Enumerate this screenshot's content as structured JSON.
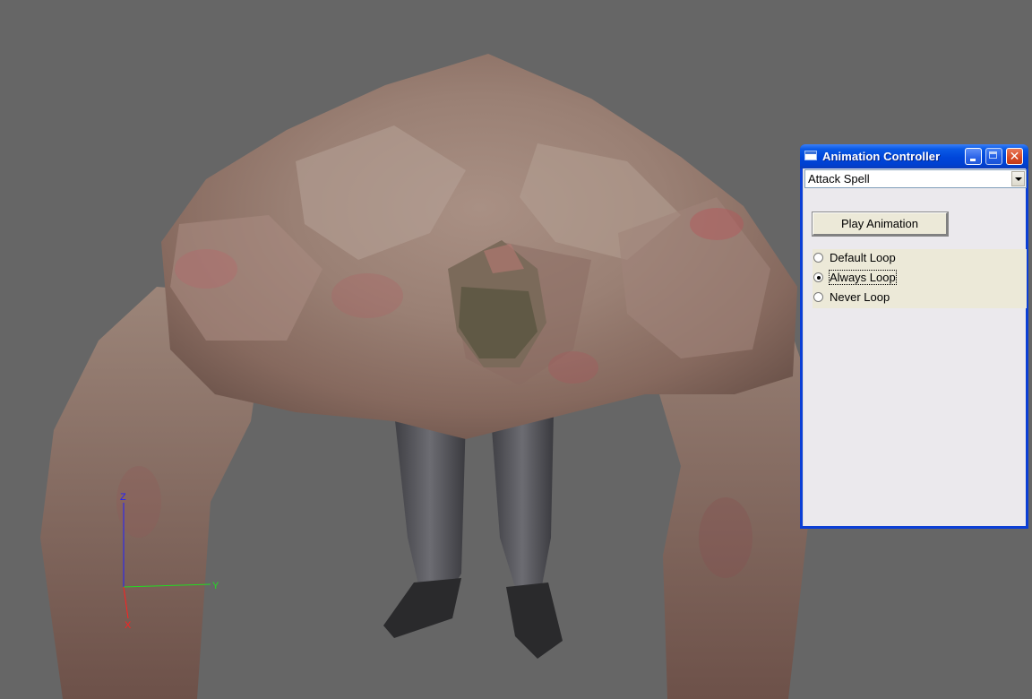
{
  "window": {
    "title": "Animation Controller",
    "animation_select": {
      "value": "Attack Spell"
    },
    "play_button": "Play Animation",
    "loop_options": [
      {
        "label": "Default Loop",
        "checked": false
      },
      {
        "label": "Always Loop",
        "checked": true
      },
      {
        "label": "Never Loop",
        "checked": false
      }
    ]
  },
  "axes": {
    "z": "Z",
    "y": "Y",
    "x": "X",
    "colors": {
      "z": "#2020ff",
      "y": "#22dd22",
      "x": "#ff2020"
    }
  },
  "viewport": {
    "background": "#666666"
  }
}
